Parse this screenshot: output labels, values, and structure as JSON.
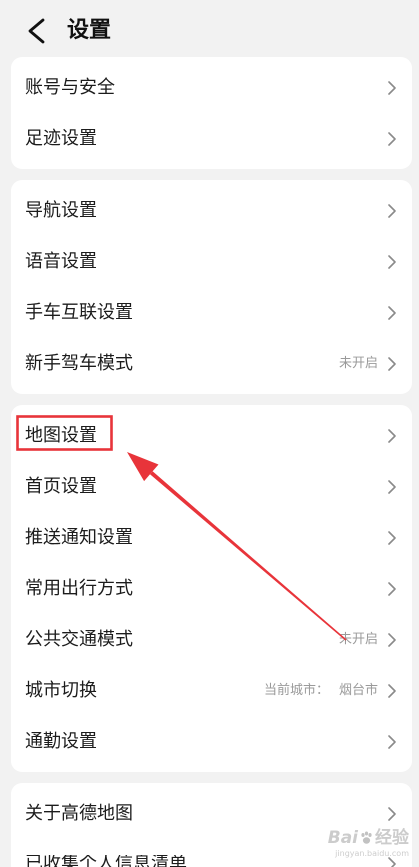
{
  "header": {
    "title": "设置",
    "back_icon": "chevron-left-icon"
  },
  "icons": {
    "row_chevron": "chevron-right-icon",
    "watermark_paw": "baidu-paw-icon"
  },
  "groups": [
    {
      "items": [
        {
          "label": "账号与安全"
        },
        {
          "label": "足迹设置"
        }
      ]
    },
    {
      "items": [
        {
          "label": "导航设置"
        },
        {
          "label": "语音设置"
        },
        {
          "label": "手车互联设置"
        },
        {
          "label": "新手驾车模式",
          "value": "未开启"
        }
      ]
    },
    {
      "items": [
        {
          "label": "地图设置",
          "annotated": true
        },
        {
          "label": "首页设置"
        },
        {
          "label": "推送通知设置"
        },
        {
          "label": "常用出行方式"
        },
        {
          "label": "公共交通模式",
          "value": "未开启"
        },
        {
          "label": "城市切换",
          "value_prefix": "当前城市：",
          "value": "烟台市"
        },
        {
          "label": "通勤设置"
        }
      ]
    },
    {
      "items": [
        {
          "label": "关于高德地图"
        },
        {
          "label": "已收集个人信息清单"
        }
      ]
    }
  ],
  "watermark": {
    "brand": "Bai",
    "product": "经验",
    "url": "jingyan.baidu.com"
  },
  "colors": {
    "page_background": "#f2f2f2",
    "card_background": "#ffffff",
    "label_text": "#1c1c1c",
    "secondary_text": "#9a9a9a",
    "chevron": "#8a8a8a",
    "annotation_red": "#e8343a"
  }
}
